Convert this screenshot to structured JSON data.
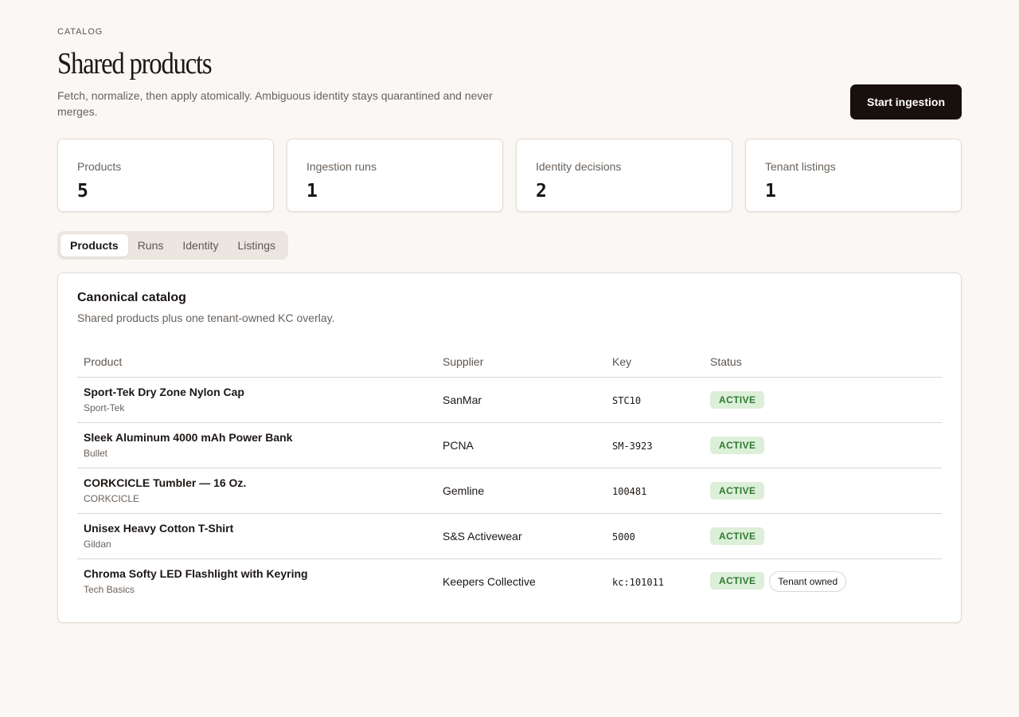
{
  "header": {
    "eyebrow": "CATALOG",
    "title": "Shared products",
    "subtitle": "Fetch, normalize, then apply atomically. Ambiguous identity stays quarantined and never merges.",
    "primary_action": "Start ingestion"
  },
  "stats": [
    {
      "label": "Products",
      "value": "5"
    },
    {
      "label": "Ingestion runs",
      "value": "1"
    },
    {
      "label": "Identity decisions",
      "value": "2"
    },
    {
      "label": "Tenant listings",
      "value": "1"
    }
  ],
  "tabs": [
    {
      "label": "Products",
      "active": true
    },
    {
      "label": "Runs",
      "active": false
    },
    {
      "label": "Identity",
      "active": false
    },
    {
      "label": "Listings",
      "active": false
    }
  ],
  "panel": {
    "title": "Canonical catalog",
    "subtitle": "Shared products plus one tenant-owned KC overlay.",
    "columns": [
      "Product",
      "Supplier",
      "Key",
      "Status"
    ],
    "rows": [
      {
        "name": "Sport-Tek Dry Zone Nylon Cap",
        "brand": "Sport-Tek",
        "supplier": "SanMar",
        "key": "STC10",
        "status": "ACTIVE",
        "extra": ""
      },
      {
        "name": "Sleek Aluminum 4000 mAh Power Bank",
        "brand": "Bullet",
        "supplier": "PCNA",
        "key": "SM-3923",
        "status": "ACTIVE",
        "extra": ""
      },
      {
        "name": "CORKCICLE Tumbler — 16 Oz.",
        "brand": "CORKCICLE",
        "supplier": "Gemline",
        "key": "100481",
        "status": "ACTIVE",
        "extra": ""
      },
      {
        "name": "Unisex Heavy Cotton T-Shirt",
        "brand": "Gildan",
        "supplier": "S&S Activewear",
        "key": "5000",
        "status": "ACTIVE",
        "extra": ""
      },
      {
        "name": "Chroma Softy LED Flashlight with Keyring",
        "brand": "Tech Basics",
        "supplier": "Keepers Collective",
        "key": "kc:101011",
        "status": "ACTIVE",
        "extra": "Tenant owned"
      }
    ]
  },
  "colors": {
    "background": "#faf7f4",
    "primary_button": "#17100c",
    "active_badge_bg": "#dcefd8",
    "active_badge_text": "#2f7a34"
  }
}
